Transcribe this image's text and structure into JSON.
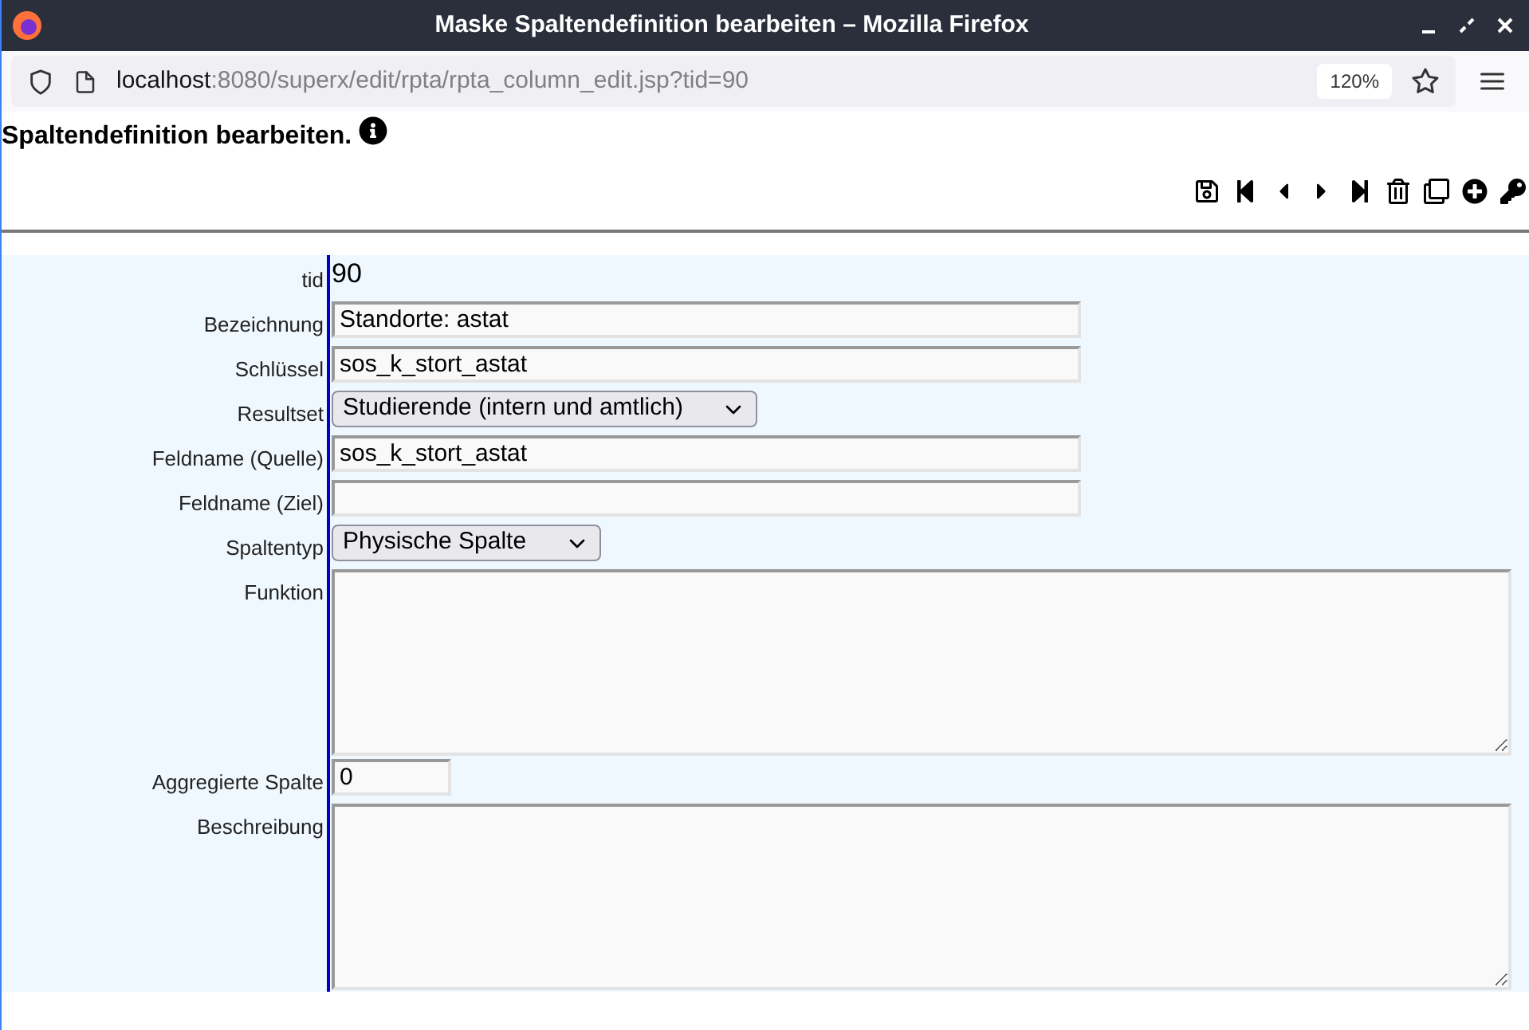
{
  "window": {
    "title": "Maske Spaltendefinition bearbeiten – Mozilla Firefox"
  },
  "address_bar": {
    "host": "localhost",
    "path": ":8080/superx/edit/rpta/rpta_column_edit.jsp?tid=90",
    "zoom": "120%"
  },
  "page": {
    "heading": "Spaltendefinition bearbeiten."
  },
  "form": [
    {
      "kind": "static",
      "label": "tid",
      "value": "90"
    },
    {
      "kind": "text",
      "label": "Bezeichnung",
      "value": "Standorte: astat"
    },
    {
      "kind": "text",
      "label": "Schlüssel",
      "value": "sos_k_stort_astat"
    },
    {
      "kind": "select",
      "label": "Resultset",
      "value": "Studierende (intern und amtlich)"
    },
    {
      "kind": "text",
      "label": "Feldname (Quelle)",
      "value": "sos_k_stort_astat"
    },
    {
      "kind": "text",
      "label": "Feldname (Ziel)"
    },
    {
      "kind": "select",
      "label": "Spaltentyp",
      "value": "Physische Spalte"
    },
    {
      "kind": "textarea",
      "label": "Funktion"
    },
    {
      "kind": "short",
      "label": "Aggregierte Spalte",
      "value": "0"
    },
    {
      "kind": "textarea",
      "label": "Beschreibung"
    }
  ]
}
